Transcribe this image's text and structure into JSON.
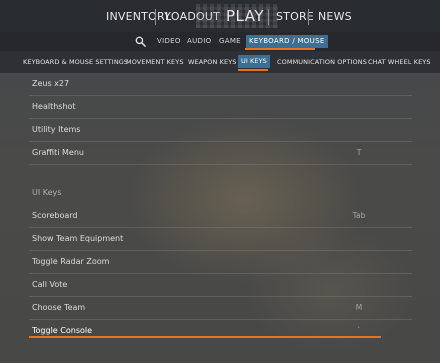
{
  "top_nav": {
    "inventory": "INVENTORY",
    "loadout": "LOADOUT",
    "play": "PLAY",
    "store": "STORE",
    "news": "NEWS"
  },
  "sub_nav": {
    "search_icon": "search-icon",
    "video": "VIDEO",
    "audio": "AUDIO",
    "game": "GAME",
    "keyboard_mouse": "KEYBOARD / MOUSE"
  },
  "tabs": [
    {
      "label": "KEYBOARD & MOUSE SETTINGS"
    },
    {
      "label": "MOVEMENT KEYS"
    },
    {
      "label": "WEAPON KEYS"
    },
    {
      "label": "UI KEYS"
    },
    {
      "label": "COMMUNICATION OPTIONS"
    },
    {
      "label": "CHAT WHEEL KEYS"
    }
  ],
  "active_tab": "UI KEYS",
  "upper_rows": [
    {
      "label": "Zeus x27",
      "key": ""
    },
    {
      "label": "Healthshot",
      "key": ""
    },
    {
      "label": "Utility Items",
      "key": ""
    },
    {
      "label": "Graffiti Menu",
      "key": "T"
    }
  ],
  "section_title": "UI Keys",
  "ui_rows": [
    {
      "label": "Scoreboard",
      "key": "Tab"
    },
    {
      "label": "Show Team Equipment",
      "key": ""
    },
    {
      "label": "Toggle Radar Zoom",
      "key": ""
    },
    {
      "label": "Call Vote",
      "key": ""
    },
    {
      "label": "Choose Team",
      "key": "M"
    },
    {
      "label": "Toggle Console",
      "key": "`"
    }
  ],
  "colors": {
    "accent_orange": "#e8731c",
    "active_tab_blue": "#3b6f93"
  }
}
